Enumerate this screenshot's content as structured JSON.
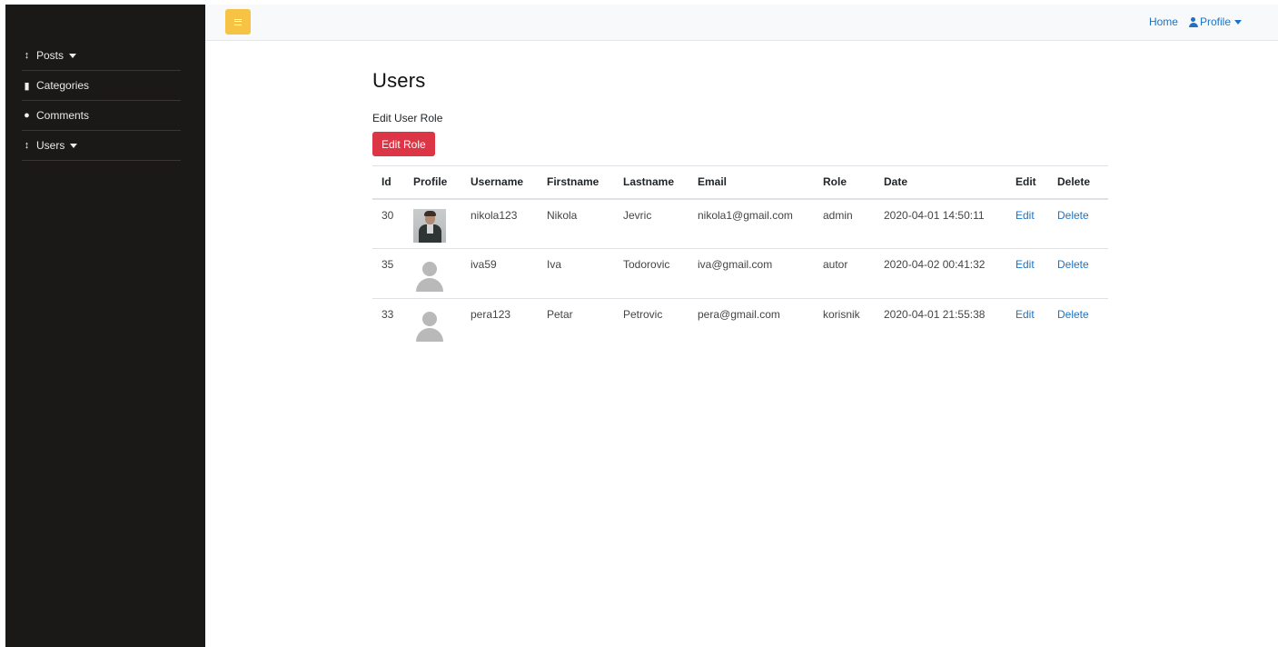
{
  "sidebar": {
    "items": [
      {
        "label": "Posts",
        "icon": "up-down-arrow-icon",
        "dropdown": true
      },
      {
        "label": "Categories",
        "icon": "file-icon",
        "dropdown": false
      },
      {
        "label": "Comments",
        "icon": "comment-icon",
        "dropdown": false
      },
      {
        "label": "Users",
        "icon": "up-down-arrow-icon",
        "dropdown": true
      }
    ]
  },
  "topbar": {
    "toggle_icon": "menu-bars-icon",
    "home_label": "Home",
    "profile_label": "Profile",
    "toggle_color": "#f6c344",
    "link_color": "#1a73c8"
  },
  "main": {
    "title": "Users",
    "subtitle": "Edit User Role",
    "edit_role_label": "Edit Role",
    "edit_role_color": "#dc3545"
  },
  "table": {
    "headers": [
      "Id",
      "Profile",
      "Username",
      "Firstname",
      "Lastname",
      "Email",
      "Role",
      "Date",
      "Edit",
      "Delete"
    ],
    "rows": [
      {
        "id": "30",
        "avatar": "photo",
        "username": "nikola123",
        "firstname": "Nikola",
        "lastname": "Jevric",
        "email": "nikola1@gmail.com",
        "role": "admin",
        "date": "2020-04-01 14:50:11",
        "edit": "Edit",
        "delete": "Delete"
      },
      {
        "id": "35",
        "avatar": "default",
        "username": "iva59",
        "firstname": "Iva",
        "lastname": "Todorovic",
        "email": "iva@gmail.com",
        "role": "autor",
        "date": "2020-04-02 00:41:32",
        "edit": "Edit",
        "delete": "Delete"
      },
      {
        "id": "33",
        "avatar": "default",
        "username": "pera123",
        "firstname": "Petar",
        "lastname": "Petrovic",
        "email": "pera@gmail.com",
        "role": "korisnik",
        "date": "2020-04-01 21:55:38",
        "edit": "Edit",
        "delete": "Delete"
      }
    ]
  }
}
